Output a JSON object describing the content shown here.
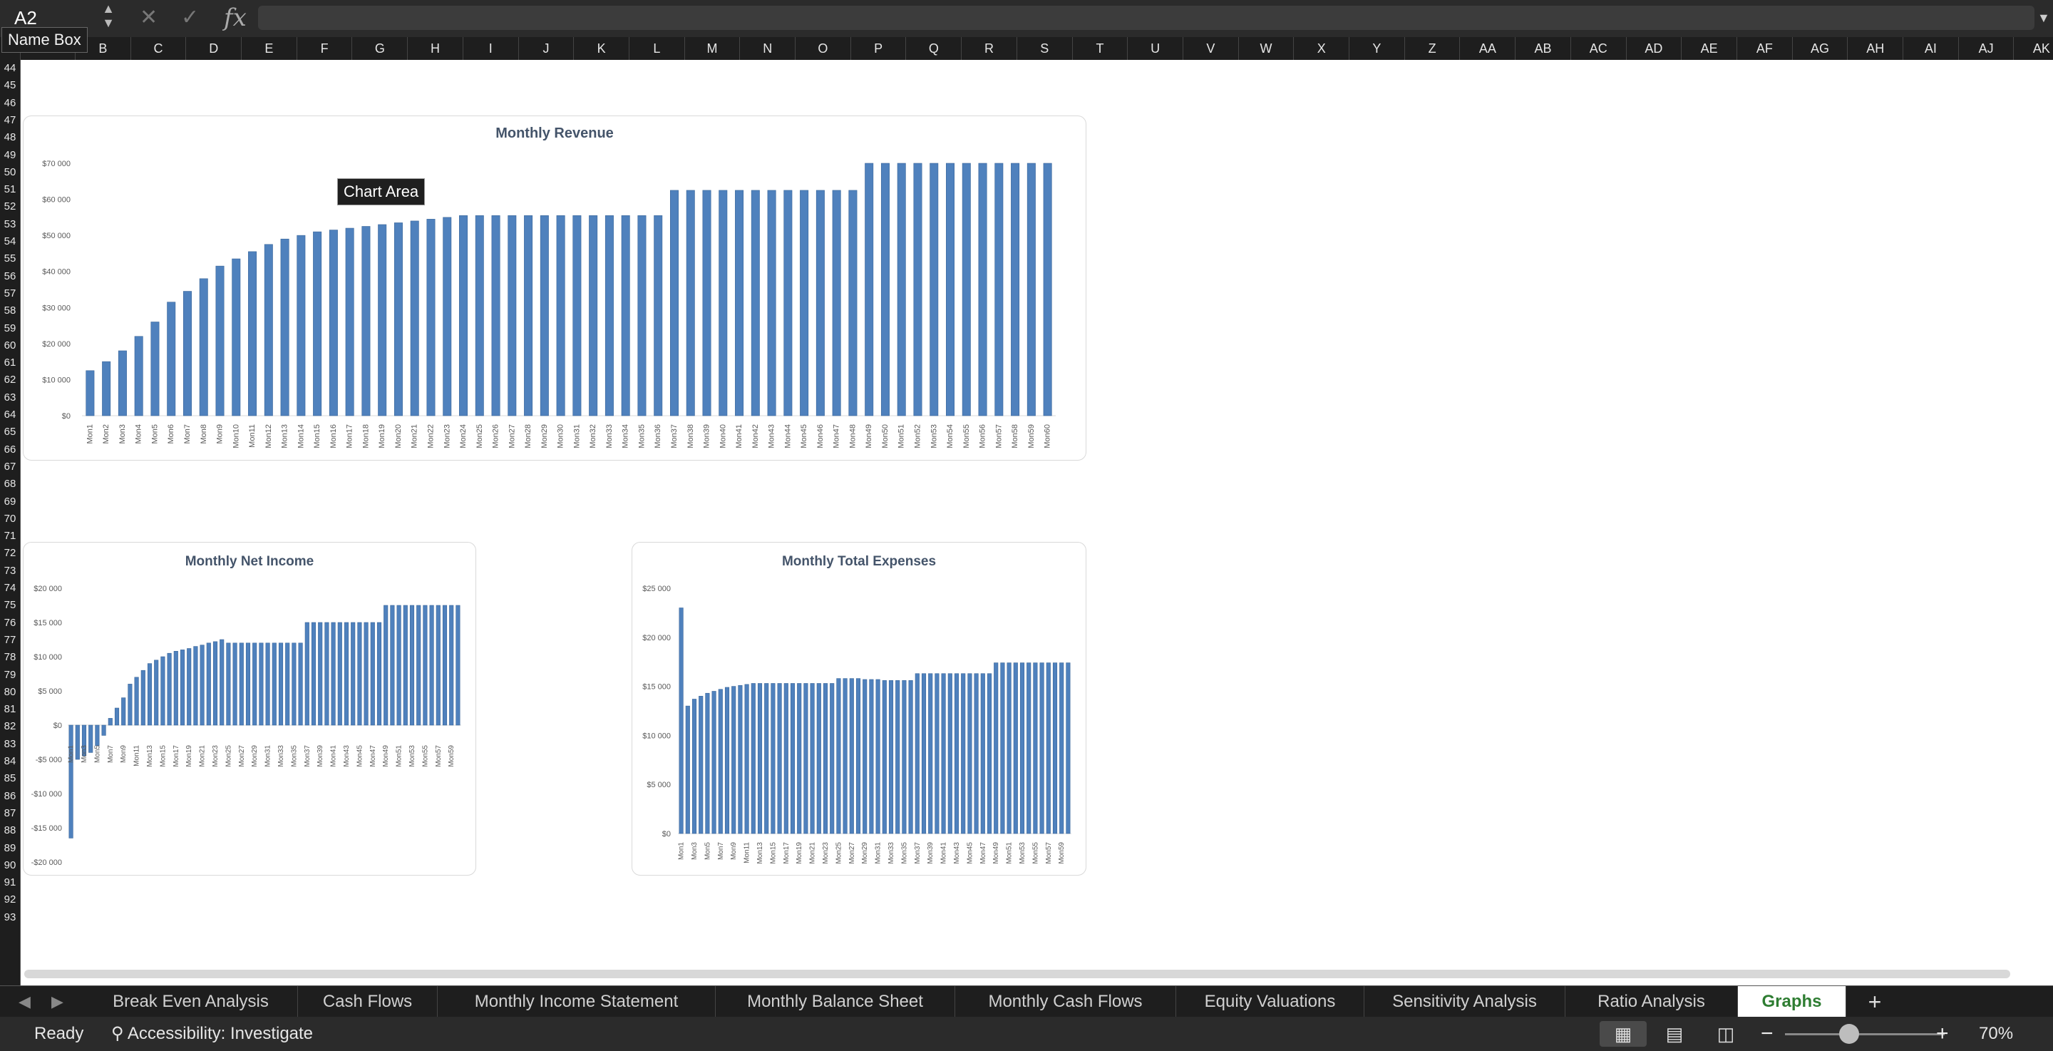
{
  "formula_bar": {
    "name_box": "A2",
    "name_box_tooltip": "Name Box",
    "cancel_icon": "✕",
    "confirm_icon": "✓",
    "fx_label": "fx",
    "formula": ""
  },
  "columns": [
    "B",
    "C",
    "D",
    "E",
    "F",
    "G",
    "H",
    "I",
    "J",
    "K",
    "L",
    "M",
    "N",
    "O",
    "P",
    "Q",
    "R",
    "S",
    "T",
    "U",
    "V",
    "W",
    "X",
    "Y",
    "Z",
    "AA",
    "AB",
    "AC",
    "AD",
    "AE",
    "AF",
    "AG",
    "AH",
    "AI",
    "AJ",
    "AK"
  ],
  "rows": [
    "44",
    "45",
    "46",
    "47",
    "48",
    "49",
    "50",
    "51",
    "52",
    "53",
    "54",
    "55",
    "56",
    "57",
    "58",
    "59",
    "60",
    "61",
    "62",
    "63",
    "64",
    "65",
    "66",
    "67",
    "68",
    "69",
    "70",
    "71",
    "72",
    "73",
    "74",
    "75",
    "76",
    "77",
    "78",
    "79",
    "80",
    "81",
    "82",
    "83",
    "84",
    "85",
    "86",
    "87",
    "88",
    "89",
    "90",
    "91",
    "92",
    "93"
  ],
  "tooltip": "Chart Area",
  "tabs": {
    "sheets": [
      "Break Even Analysis",
      "Cash Flows",
      "Monthly Income Statement",
      "Monthly Balance Sheet",
      "Monthly Cash Flows",
      "Equity Valuations",
      "Sensitivity Analysis",
      "Ratio Analysis",
      "Graphs"
    ],
    "active": "Graphs",
    "add_label": "+",
    "prev_icon": "◀",
    "next_icon": "▶"
  },
  "status": {
    "ready": "Ready",
    "accessibility": "Accessibility: Investigate",
    "zoom_minus": "−",
    "zoom_plus": "+",
    "zoom_value": "70%",
    "zoom_level": 0.4
  },
  "icons": {
    "accessibility": "accessibility-icon",
    "normal_view": "grid-view-icon",
    "page_layout": "page-layout-icon",
    "page_break": "page-break-icon"
  },
  "chart_data": [
    {
      "type": "bar",
      "title": "Monthly Revenue",
      "categories": [
        "Mon1",
        "Mon2",
        "Mon3",
        "Mon4",
        "Mon5",
        "Mon6",
        "Mon7",
        "Mon8",
        "Mon9",
        "Mon10",
        "Mon11",
        "Mon12",
        "Mon13",
        "Mon14",
        "Mon15",
        "Mon16",
        "Mon17",
        "Mon18",
        "Mon19",
        "Mon20",
        "Mon21",
        "Mon22",
        "Mon23",
        "Mon24",
        "Mon25",
        "Mon26",
        "Mon27",
        "Mon28",
        "Mon29",
        "Mon30",
        "Mon31",
        "Mon32",
        "Mon33",
        "Mon34",
        "Mon35",
        "Mon36",
        "Mon37",
        "Mon38",
        "Mon39",
        "Mon40",
        "Mon41",
        "Mon42",
        "Mon43",
        "Mon44",
        "Mon45",
        "Mon46",
        "Mon47",
        "Mon48",
        "Mon49",
        "Mon50",
        "Mon51",
        "Mon52",
        "Mon53",
        "Mon54",
        "Mon55",
        "Mon56",
        "Mon57",
        "Mon58",
        "Mon59",
        "Mon60"
      ],
      "category_labels": [
        "Mon1",
        "Mon2",
        "Mon3",
        "Mon4",
        "Mon5",
        "Mon6",
        "Mon7",
        "Mon8",
        "Mon9",
        "Mon10",
        "Mon11",
        "Mon12",
        "Mon13",
        "Mon14",
        "Mon15",
        "Mon16",
        "Mon17",
        "Mon18",
        "Mon19",
        "Mon20",
        "Mon21",
        "Mon22",
        "Mon23",
        "Mon24",
        "Mon25",
        "Mon26",
        "Mon27",
        "Mon28",
        "Mon29",
        "Mon30",
        "Mon31",
        "Mon32",
        "Mon33",
        "Mon34",
        "Mon35",
        "Mon36",
        "Mon37",
        "Mon38",
        "Mon39",
        "Mon40",
        "Mon41",
        "Mon42",
        "Mon43",
        "Mon44",
        "Mon45",
        "Mon46",
        "Mon47",
        "Mon48",
        "Mon49",
        "Mon50",
        "Mon51",
        "Mon52",
        "Mon53",
        "Mon54",
        "Mon55",
        "Mon56",
        "Mon57",
        "Mon58",
        "Mon59",
        "Mon60"
      ],
      "values": [
        12500,
        15000,
        18000,
        22000,
        26000,
        31500,
        34500,
        38000,
        41500,
        43500,
        45500,
        47500,
        49000,
        50000,
        51000,
        51500,
        52000,
        52500,
        53000,
        53500,
        54000,
        54500,
        55000,
        55500,
        55500,
        55500,
        55500,
        55500,
        55500,
        55500,
        55500,
        55500,
        55500,
        55500,
        55500,
        55500,
        62500,
        62500,
        62500,
        62500,
        62500,
        62500,
        62500,
        62500,
        62500,
        62500,
        62500,
        62500,
        70000,
        70000,
        70000,
        70000,
        70000,
        70000,
        70000,
        70000,
        70000,
        70000,
        70000,
        70000
      ],
      "yticks": [
        "$0",
        "$10 000",
        "$20 000",
        "$30 000",
        "$40 000",
        "$50 000",
        "$60 000",
        "$70 000"
      ],
      "ylim": [
        0,
        70000
      ],
      "grid": false,
      "bar_color": "#4f81bd"
    },
    {
      "type": "bar",
      "title": "Monthly Net Income",
      "categories": [
        "Mon1",
        "Mon2",
        "Mon3",
        "Mon4",
        "Mon5",
        "Mon6",
        "Mon7",
        "Mon8",
        "Mon9",
        "Mon10",
        "Mon11",
        "Mon12",
        "Mon13",
        "Mon14",
        "Mon15",
        "Mon16",
        "Mon17",
        "Mon18",
        "Mon19",
        "Mon20",
        "Mon21",
        "Mon22",
        "Mon23",
        "Mon24",
        "Mon25",
        "Mon26",
        "Mon27",
        "Mon28",
        "Mon29",
        "Mon30",
        "Mon31",
        "Mon32",
        "Mon33",
        "Mon34",
        "Mon35",
        "Mon36",
        "Mon37",
        "Mon38",
        "Mon39",
        "Mon40",
        "Mon41",
        "Mon42",
        "Mon43",
        "Mon44",
        "Mon45",
        "Mon46",
        "Mon47",
        "Mon48",
        "Mon49",
        "Mon50",
        "Mon51",
        "Mon52",
        "Mon53",
        "Mon54",
        "Mon55",
        "Mon56",
        "Mon57",
        "Mon58",
        "Mon59",
        "Mon60"
      ],
      "category_labels": [
        "Mon1",
        "Mon3",
        "Mon5",
        "Mon7",
        "Mon9",
        "Mon11",
        "Mon13",
        "Mon15",
        "Mon17",
        "Mon19",
        "Mon21",
        "Mon23",
        "Mon25",
        "Mon27",
        "Mon29",
        "Mon31",
        "Mon33",
        "Mon35",
        "Mon37",
        "Mon39",
        "Mon41",
        "Mon43",
        "Mon45",
        "Mon47",
        "Mon49",
        "Mon51",
        "Mon53",
        "Mon55",
        "Mon57",
        "Mon59"
      ],
      "values": [
        -16500,
        -5000,
        -4500,
        -4000,
        -3000,
        -1500,
        1000,
        2500,
        4000,
        6000,
        7000,
        8000,
        9000,
        9500,
        10000,
        10500,
        10800,
        11000,
        11200,
        11500,
        11700,
        12000,
        12200,
        12500,
        12000,
        12000,
        12000,
        12000,
        12000,
        12000,
        12000,
        12000,
        12000,
        12000,
        12000,
        12000,
        15000,
        15000,
        15000,
        15000,
        15000,
        15000,
        15000,
        15000,
        15000,
        15000,
        15000,
        15000,
        17500,
        17500,
        17500,
        17500,
        17500,
        17500,
        17500,
        17500,
        17500,
        17500,
        17500,
        17500
      ],
      "yticks": [
        "-$20 000",
        "-$15 000",
        "-$10 000",
        "-$5 000",
        "$0",
        "$5 000",
        "$10 000",
        "$15 000",
        "$20 000"
      ],
      "ylim": [
        -20000,
        20000
      ],
      "grid": false,
      "bar_color": "#4f81bd"
    },
    {
      "type": "bar",
      "title": "Monthly Total Expenses",
      "categories": [
        "Mon1",
        "Mon2",
        "Mon3",
        "Mon4",
        "Mon5",
        "Mon6",
        "Mon7",
        "Mon8",
        "Mon9",
        "Mon10",
        "Mon11",
        "Mon12",
        "Mon13",
        "Mon14",
        "Mon15",
        "Mon16",
        "Mon17",
        "Mon18",
        "Mon19",
        "Mon20",
        "Mon21",
        "Mon22",
        "Mon23",
        "Mon24",
        "Mon25",
        "Mon26",
        "Mon27",
        "Mon28",
        "Mon29",
        "Mon30",
        "Mon31",
        "Mon32",
        "Mon33",
        "Mon34",
        "Mon35",
        "Mon36",
        "Mon37",
        "Mon38",
        "Mon39",
        "Mon40",
        "Mon41",
        "Mon42",
        "Mon43",
        "Mon44",
        "Mon45",
        "Mon46",
        "Mon47",
        "Mon48",
        "Mon49",
        "Mon50",
        "Mon51",
        "Mon52",
        "Mon53",
        "Mon54",
        "Mon55",
        "Mon56",
        "Mon57",
        "Mon58",
        "Mon59",
        "Mon60"
      ],
      "category_labels": [
        "Mon1",
        "Mon3",
        "Mon5",
        "Mon7",
        "Mon9",
        "Mon11",
        "Mon13",
        "Mon15",
        "Mon17",
        "Mon19",
        "Mon21",
        "Mon23",
        "Mon25",
        "Mon27",
        "Mon29",
        "Mon31",
        "Mon33",
        "Mon35",
        "Mon37",
        "Mon39",
        "Mon41",
        "Mon43",
        "Mon45",
        "Mon47",
        "Mon49",
        "Mon51",
        "Mon53",
        "Mon55",
        "Mon57",
        "Mon59"
      ],
      "values": [
        23000,
        13000,
        13700,
        14000,
        14300,
        14500,
        14700,
        14900,
        15000,
        15100,
        15200,
        15300,
        15300,
        15300,
        15300,
        15300,
        15300,
        15300,
        15300,
        15300,
        15300,
        15300,
        15300,
        15300,
        15800,
        15800,
        15800,
        15800,
        15700,
        15700,
        15700,
        15600,
        15600,
        15600,
        15600,
        15600,
        16300,
        16300,
        16300,
        16300,
        16300,
        16300,
        16300,
        16300,
        16300,
        16300,
        16300,
        16300,
        17400,
        17400,
        17400,
        17400,
        17400,
        17400,
        17400,
        17400,
        17400,
        17400,
        17400,
        17400
      ],
      "yticks": [
        "$0",
        "$5 000",
        "$10 000",
        "$15 000",
        "$20 000",
        "$25 000"
      ],
      "ylim": [
        0,
        25000
      ],
      "grid": false,
      "bar_color": "#4f81bd"
    }
  ]
}
